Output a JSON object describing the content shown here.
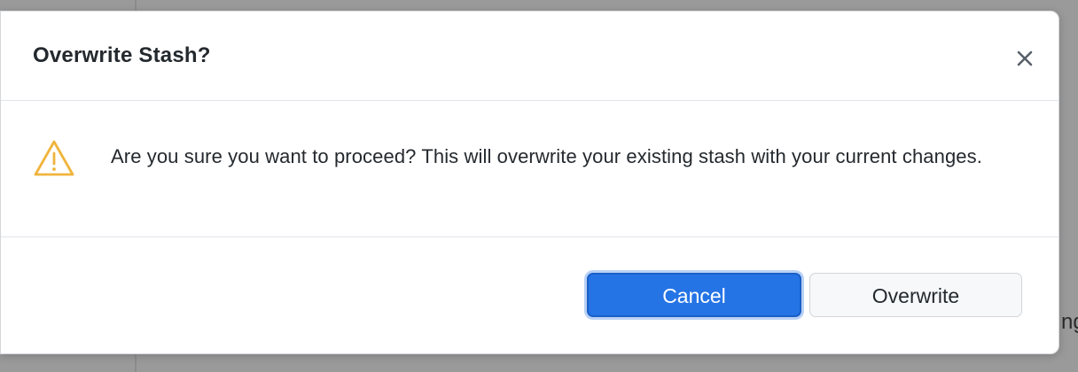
{
  "background": {
    "partial_text": "ng"
  },
  "dialog": {
    "title": "Overwrite Stash?",
    "close_icon": "close-icon",
    "warning_icon": "warning-triangle-icon",
    "message": "Are you sure you want to proceed? This will overwrite your existing stash with your current changes.",
    "buttons": {
      "cancel_label": "Cancel",
      "overwrite_label": "Overwrite"
    }
  },
  "colors": {
    "primary_button": "#2574e6",
    "warning_icon": "#f0b43c",
    "backdrop": "#9a9a9a"
  }
}
